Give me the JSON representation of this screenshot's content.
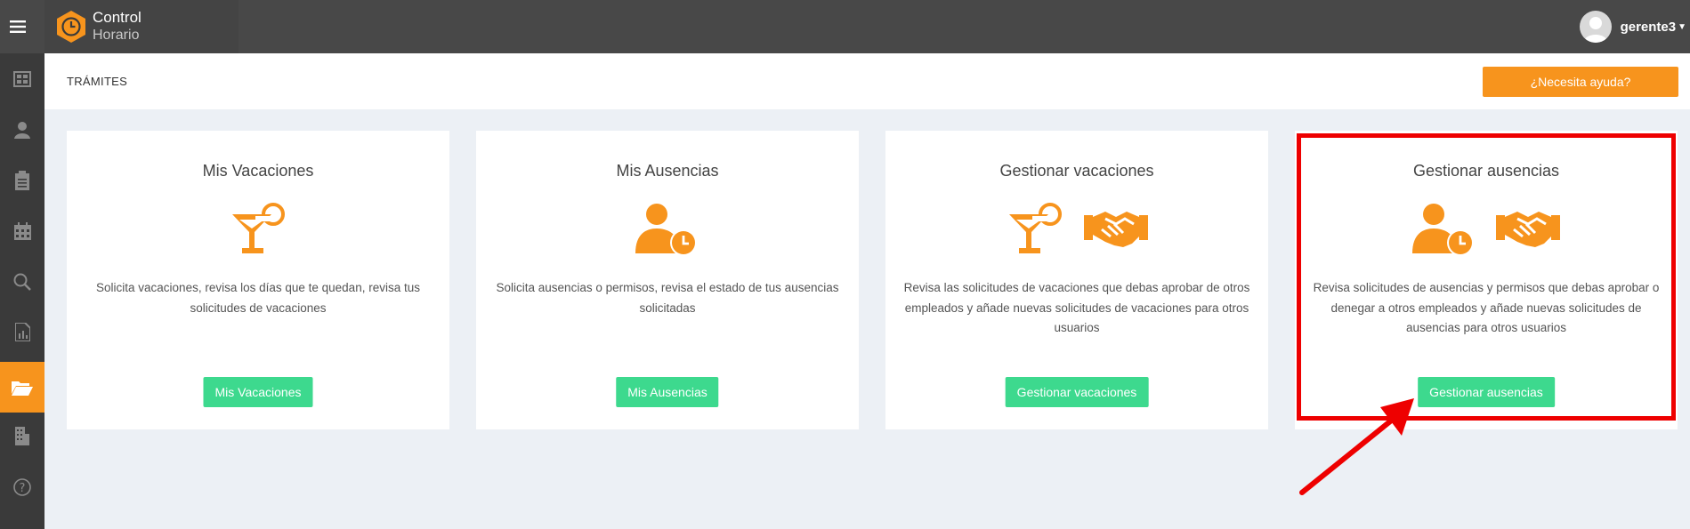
{
  "app": {
    "logo_line1": "Control",
    "logo_line2": "Horario"
  },
  "user": {
    "name": "gerente3"
  },
  "sidebar": {
    "items": [
      {
        "icon": "dashboard-icon"
      },
      {
        "icon": "user-icon"
      },
      {
        "icon": "clipboard-icon"
      },
      {
        "icon": "calendar-icon"
      },
      {
        "icon": "search-icon"
      },
      {
        "icon": "report-icon"
      },
      {
        "icon": "folder-open-icon",
        "active": true
      },
      {
        "icon": "building-icon"
      },
      {
        "icon": "help-icon"
      }
    ]
  },
  "page": {
    "title": "TRÁMITES",
    "help_label": "¿Necesita ayuda?"
  },
  "cards": [
    {
      "title": "Mis Vacaciones",
      "icons": [
        "cocktail-icon"
      ],
      "description": "Solicita vacaciones, revisa los días que te quedan, revisa tus solicitudes de vacaciones",
      "button": "Mis Vacaciones"
    },
    {
      "title": "Mis Ausencias",
      "icons": [
        "user-clock-icon"
      ],
      "description": "Solicita ausencias o permisos, revisa el estado de tus ausencias solicitadas",
      "button": "Mis Ausencias"
    },
    {
      "title": "Gestionar vacaciones",
      "icons": [
        "cocktail-icon",
        "handshake-icon"
      ],
      "description": "Revisa las solicitudes de vacaciones que debas aprobar de otros empleados y añade nuevas solicitudes de vacaciones para otros usuarios",
      "button": "Gestionar vacaciones"
    },
    {
      "title": "Gestionar ausencias",
      "icons": [
        "user-clock-icon",
        "handshake-icon"
      ],
      "description": "Revisa solicitudes de ausencias y permisos que debas aprobar o denegar a otros empleados y añade nuevas solicitudes de ausencias para otros usuarios",
      "button": "Gestionar ausencias"
    }
  ],
  "colors": {
    "accent": "#f7941d",
    "button_green": "#3dd98e",
    "topbar": "#484848",
    "sidebar": "#3a3a3a",
    "annotation_red": "#ee0000"
  }
}
